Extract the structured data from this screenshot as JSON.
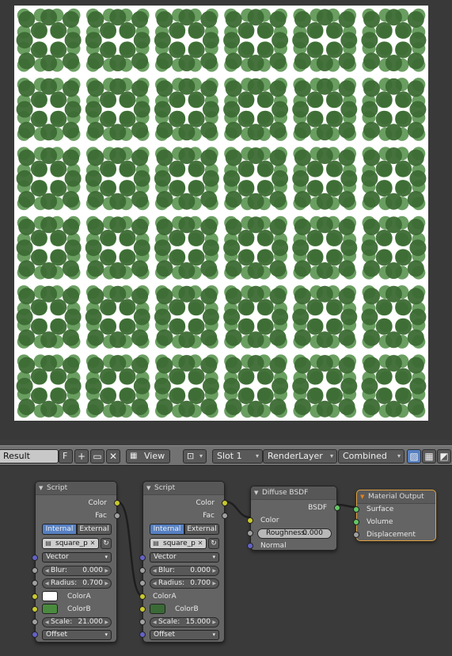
{
  "header": {
    "image_name": "Result",
    "fake_user_label": "F",
    "view_menu": "View",
    "slot": "Slot 1",
    "layer": "RenderLayer",
    "pass": "Combined"
  },
  "render": {
    "background_color": "#ffffff",
    "dark_color": "#3c6b33",
    "light_color": "#5a9450",
    "tile_columns": 6,
    "tile_rows": 6
  },
  "nodes": {
    "script1": {
      "title": "Script",
      "out_color": "Color",
      "out_fac": "Fac",
      "mode_internal": "Internal",
      "mode_external": "External",
      "script_name": "square_p",
      "vector_label": "Vector",
      "blur_label": "Blur:",
      "blur_value": "0.000",
      "radius_label": "Radius:",
      "radius_value": "0.700",
      "colora_label": "ColorA",
      "colorb_label": "ColorB",
      "scale_label": "Scale:",
      "scale_value": "21.000",
      "offset_label": "Offset"
    },
    "script2": {
      "title": "Script",
      "out_color": "Color",
      "out_fac": "Fac",
      "mode_internal": "Internal",
      "mode_external": "External",
      "script_name": "square_p",
      "vector_label": "Vector",
      "blur_label": "Blur:",
      "blur_value": "0.000",
      "radius_label": "Radius:",
      "radius_value": "0.700",
      "colora_label": "ColorA",
      "colorb_label": "ColorB",
      "scale_label": "Scale:",
      "scale_value": "15.000",
      "offset_label": "Offset"
    },
    "diffuse": {
      "title": "Diffuse BSDF",
      "out_bsdf": "BSDF",
      "color_label": "Color",
      "roughness_label": "Roughness:",
      "roughness_value": "0.000",
      "normal_label": "Normal"
    },
    "output": {
      "title": "Material Output",
      "surface_label": "Surface",
      "volume_label": "Volume",
      "displacement_label": "Displacement"
    }
  },
  "colors": {
    "script1_colora": "#ffffff",
    "script1_colorb": "#4a8a3e",
    "script2_colorb": "#3a6a35"
  }
}
